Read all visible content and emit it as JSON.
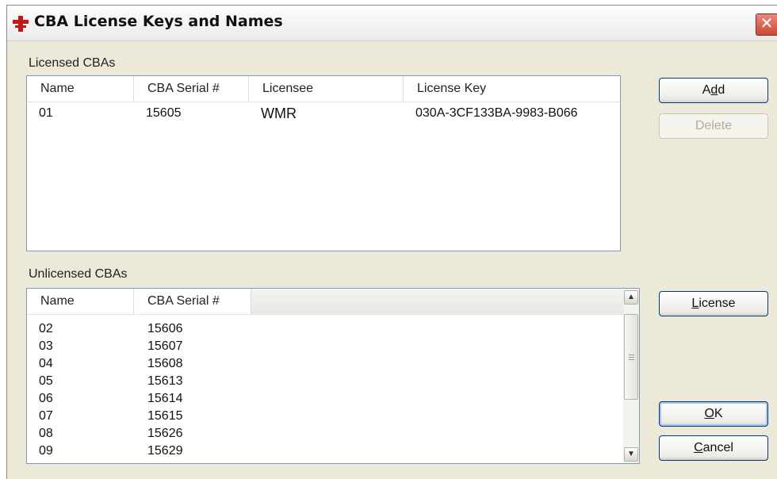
{
  "window": {
    "title": "CBA License Keys and Names",
    "close_symbol": "✕"
  },
  "licensed": {
    "label": "Licensed CBAs",
    "columns": [
      "Name",
      "CBA Serial #",
      "Licensee",
      "License Key"
    ],
    "rows": [
      {
        "name": "01",
        "serial": "15605",
        "licensee": "WMR",
        "key": "030A-3CF133BA-9983-B066"
      }
    ]
  },
  "unlicensed": {
    "label": "Unlicensed CBAs",
    "columns": [
      "Name",
      "CBA Serial #"
    ],
    "rows": [
      {
        "name": "02",
        "serial": "15606"
      },
      {
        "name": "03",
        "serial": "15607"
      },
      {
        "name": "04",
        "serial": "15608"
      },
      {
        "name": "05",
        "serial": "15613"
      },
      {
        "name": "06",
        "serial": "15614"
      },
      {
        "name": "07",
        "serial": "15615"
      },
      {
        "name": "08",
        "serial": "15626"
      },
      {
        "name": "09",
        "serial": "15629"
      }
    ]
  },
  "buttons": {
    "add": {
      "pre": "A",
      "key": "d",
      "post": "d"
    },
    "delete": "Delete",
    "license": {
      "pre": "",
      "key": "L",
      "post": "icense"
    },
    "ok": {
      "pre": "",
      "key": "O",
      "post": "K"
    },
    "cancel": {
      "pre": "",
      "key": "C",
      "post": "ancel"
    }
  },
  "icons": {
    "app": "red-cross-icon",
    "close": "close-icon",
    "scroll_up": "scroll-up-arrow-icon",
    "scroll_down": "scroll-down-arrow-icon"
  },
  "colors": {
    "dialog_bg": "#ece9d8",
    "list_border": "#7f9db9",
    "button_border": "#003c74",
    "close_red": "#c84a35"
  }
}
